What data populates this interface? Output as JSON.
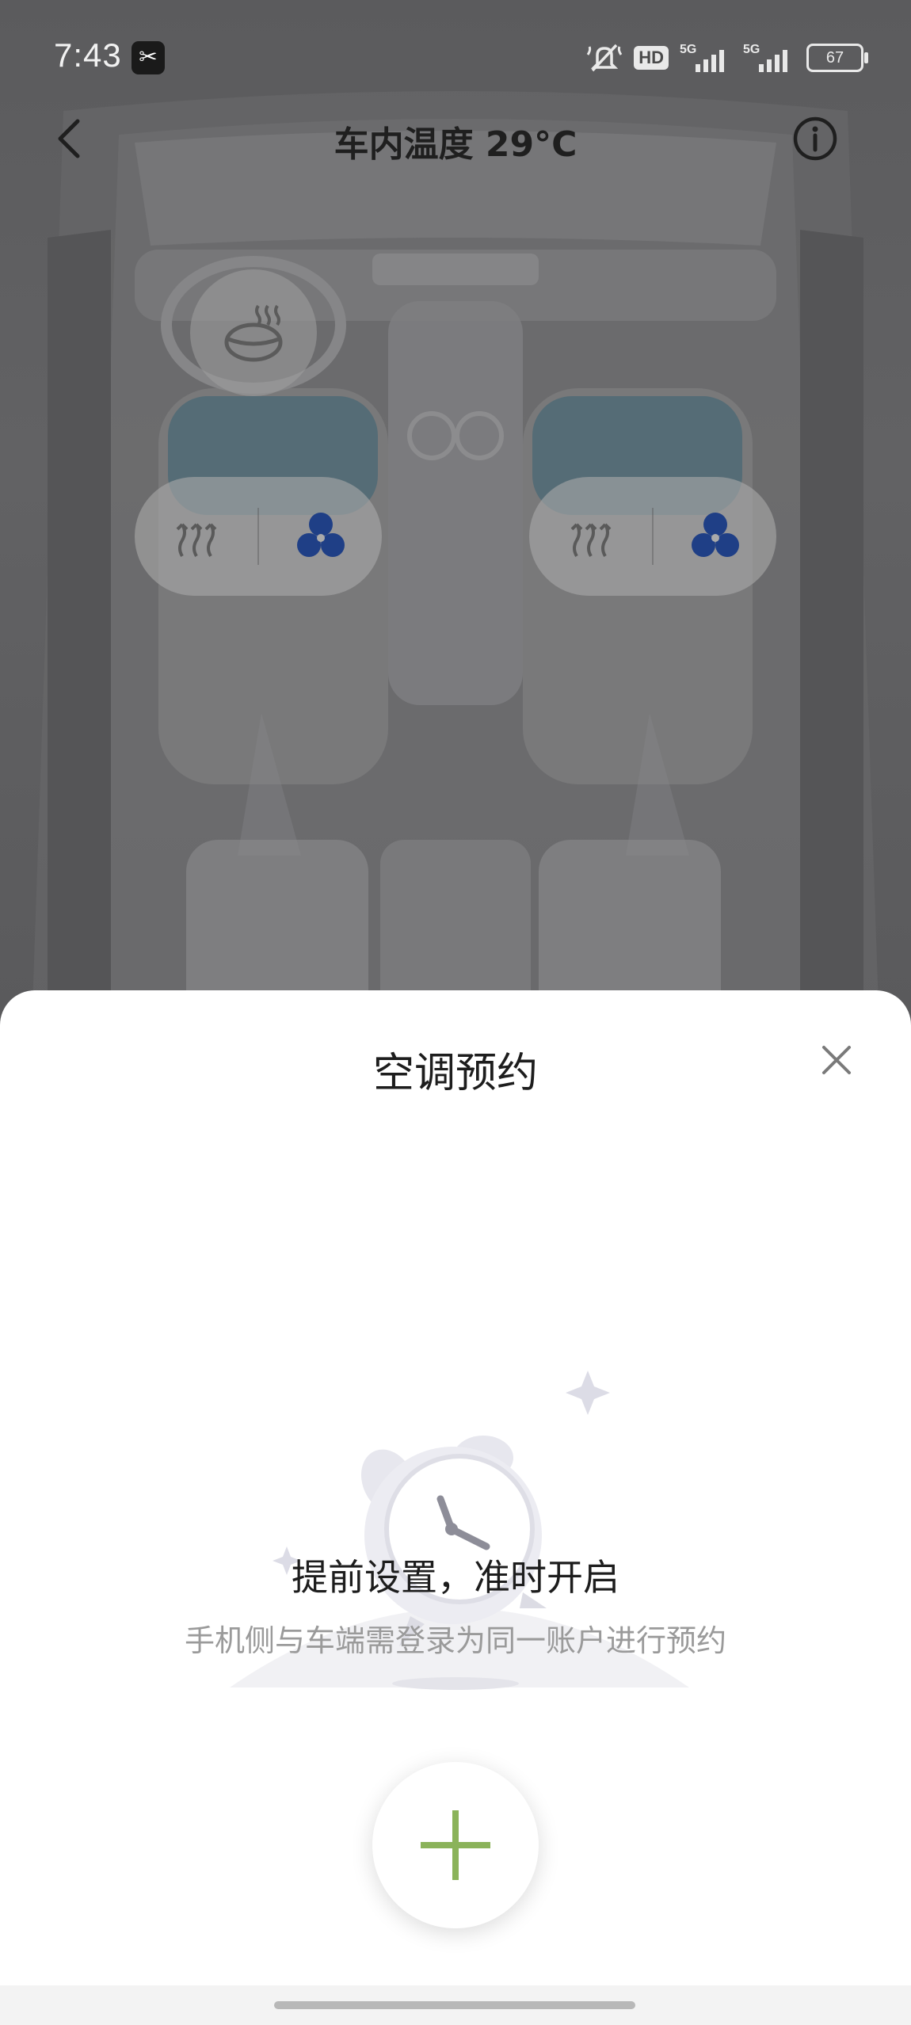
{
  "status_bar": {
    "time": "7:43",
    "app_badge": "✂",
    "hd": "HD",
    "signal_1": "5G",
    "signal_2": "5G",
    "battery": "67"
  },
  "header": {
    "title": "车内温度 29°C",
    "back_icon": "chevron-left-icon",
    "info_icon": "info-circle-icon"
  },
  "seat_controls": {
    "wheel_heat_icon": "steering-wheel-heat-icon",
    "left_seat": {
      "heat_icon": "seat-heat-icon",
      "fan_icon": "fan-icon"
    },
    "right_seat": {
      "heat_icon": "seat-heat-icon",
      "fan_icon": "fan-icon"
    },
    "fan_color": "#1f3f86"
  },
  "sheet": {
    "title": "空调预约",
    "close_icon": "close-icon",
    "illustration": "alarm-clock-illustration",
    "headline": "提前设置，准时开启",
    "subline": "手机侧与车端需登录为同一账户进行预约",
    "add_icon": "plus-icon",
    "accent_color": "#8bb35a"
  }
}
